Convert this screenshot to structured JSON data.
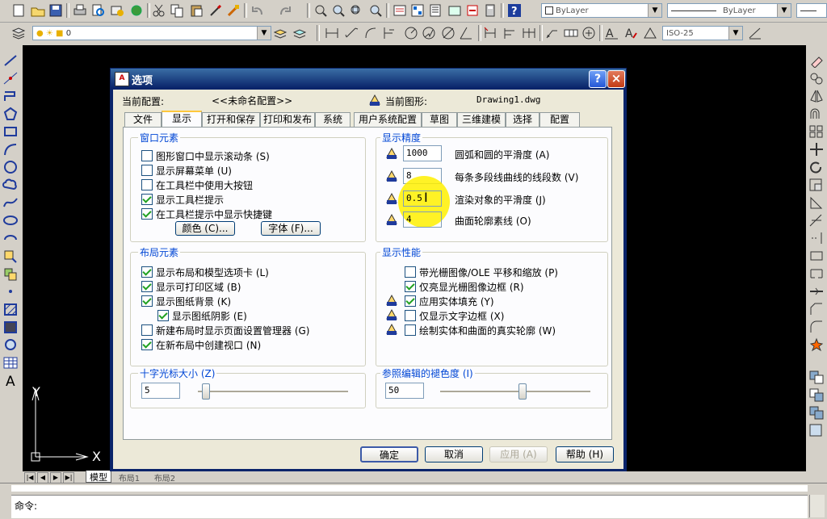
{
  "toolbar_top": {
    "layer_value": "0",
    "color_value": "ByLayer",
    "linetype_value": "ByLayer",
    "dimstyle_value": "ISO-25"
  },
  "canvas": {
    "ucs_y": "Y",
    "ucs_x": "X"
  },
  "layout_tabs": [
    "模型",
    "布局1",
    "布局2"
  ],
  "command": {
    "prompt": "命令:"
  },
  "dialog": {
    "title": "选项",
    "current_profile_label": "当前配置:",
    "current_profile_value": "<<未命名配置>>",
    "current_drawing_label": "当前图形:",
    "current_drawing_value": "Drawing1.dwg",
    "tabs": [
      "文件",
      "显示",
      "打开和保存",
      "打印和发布",
      "系统",
      "用户系统配置",
      "草图",
      "三维建模",
      "选择",
      "配置"
    ],
    "window_elements": {
      "title": "窗口元素",
      "items": [
        {
          "label": "图形窗口中显示滚动条 (S)",
          "checked": false
        },
        {
          "label": "显示屏幕菜单 (U)",
          "checked": false
        },
        {
          "label": "在工具栏中使用大按钮",
          "checked": false
        },
        {
          "label": "显示工具栏提示",
          "checked": true
        },
        {
          "label": "在工具栏提示中显示快捷键",
          "checked": true
        }
      ],
      "color_button": "颜色 (C)...",
      "font_button": "字体 (F)..."
    },
    "display_resolution": {
      "title": "显示精度",
      "items": [
        {
          "value": "1000",
          "label": "圆弧和圆的平滑度 (A)"
        },
        {
          "value": "8",
          "label": "每条多段线曲线的线段数 (V)"
        },
        {
          "value": "0.5",
          "label": "渲染对象的平滑度 (J)"
        },
        {
          "value": "4",
          "label": "曲面轮廓素线 (O)"
        }
      ]
    },
    "layout_elements": {
      "title": "布局元素",
      "items": [
        {
          "label": "显示布局和模型选项卡 (L)",
          "checked": true
        },
        {
          "label": "显示可打印区域 (B)",
          "checked": true
        },
        {
          "label": "显示图纸背景 (K)",
          "checked": true
        },
        {
          "label": "显示图纸阴影 (E)",
          "checked": true
        },
        {
          "label": "新建布局时显示页面设置管理器 (G)",
          "checked": false
        },
        {
          "label": "在新布局中创建视口 (N)",
          "checked": true
        }
      ]
    },
    "display_performance": {
      "title": "显示性能",
      "items": [
        {
          "label": "带光栅图像/OLE 平移和缩放 (P)",
          "checked": false
        },
        {
          "label": "仅亮显光栅图像边框 (R)",
          "checked": true
        },
        {
          "label": "应用实体填充 (Y)",
          "checked": true
        },
        {
          "label": "仅显示文字边框 (X)",
          "checked": false
        },
        {
          "label": "绘制实体和曲面的真实轮廓 (W)",
          "checked": false
        }
      ]
    },
    "crosshair": {
      "title": "十字光标大小 (Z)",
      "value": "5",
      "fraction": 0.05
    },
    "xref_fade": {
      "title": "参照编辑的褪色度 (I)",
      "value": "50",
      "fraction": 0.56
    },
    "buttons": {
      "ok": "确定",
      "cancel": "取消",
      "apply": "应用 (A)",
      "help": "帮助 (H)"
    },
    "title_help": "?",
    "title_close": "×"
  }
}
